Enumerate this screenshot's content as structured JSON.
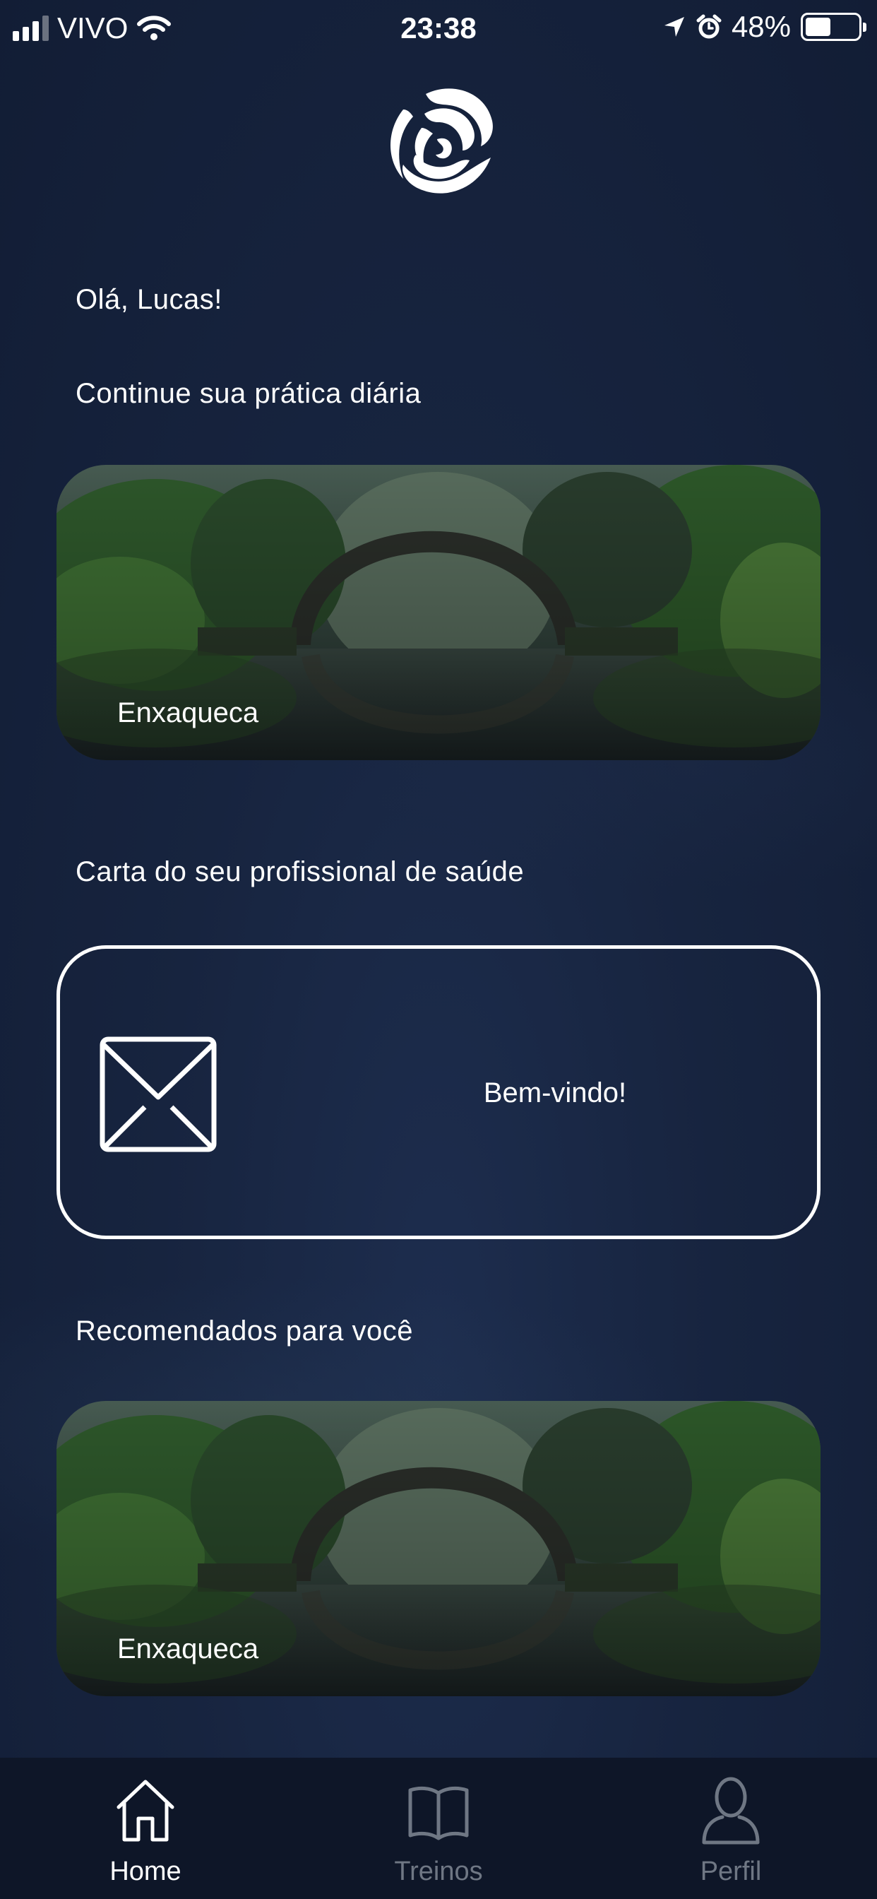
{
  "status_bar": {
    "carrier": "VIVO",
    "time": "23:38",
    "battery_percent": "48%",
    "battery_level": 0.48,
    "signal_bars_active": 3,
    "signal_bars_total": 4,
    "icons": [
      "signal-icon",
      "wifi-icon",
      "location-arrow-icon",
      "alarm-clock-icon",
      "battery-icon"
    ]
  },
  "header": {
    "logo_icon": "swirl-logo-icon"
  },
  "main": {
    "greeting": "Olá, Lucas!",
    "continue_section": {
      "title": "Continue sua prática diária",
      "card_label": "Enxaqueca"
    },
    "letter_section": {
      "title": "Carta do seu profissional de saúde",
      "card_text": "Bem-vindo!",
      "icon": "envelope-icon"
    },
    "recommended_section": {
      "title": "Recomendados para você",
      "card_label": "Enxaqueca"
    }
  },
  "tab_bar": {
    "tabs": [
      {
        "label": "Home",
        "icon": "home-icon",
        "active": true
      },
      {
        "label": "Treinos",
        "icon": "book-icon",
        "active": false
      },
      {
        "label": "Perfil",
        "icon": "user-icon",
        "active": false
      }
    ]
  },
  "colors": {
    "background": "#17243f",
    "tab_bar": "#0e1628",
    "active_tab": "#ffffff",
    "inactive_tab": "#6f7784",
    "text": "#ffffff"
  }
}
